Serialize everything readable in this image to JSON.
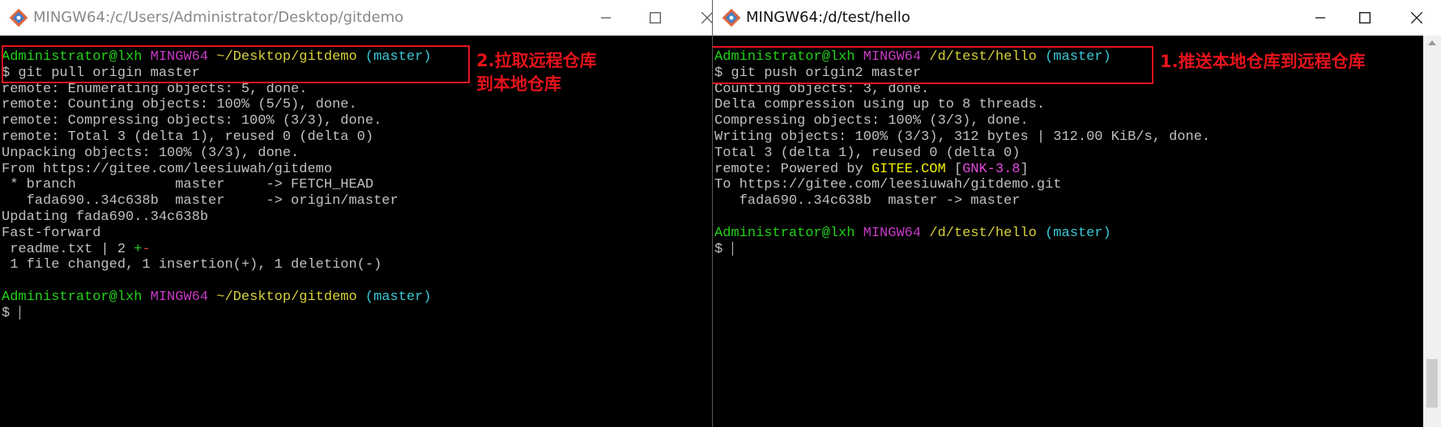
{
  "left_window": {
    "title": "MINGW64:/c/Users/Administrator/Desktop/gitdemo",
    "icon": "git-bash-icon",
    "controls": {
      "minimize": "minimize-icon",
      "maximize": "maximize-icon",
      "close": "close-icon"
    },
    "lines": [
      [
        {
          "t": "Administrator@lxh ",
          "c": "green"
        },
        {
          "t": "MINGW64 ",
          "c": "magenta"
        },
        {
          "t": "~/Desktop/gitdemo ",
          "c": "yellow"
        },
        {
          "t": "(master)",
          "c": "cyan"
        }
      ],
      [
        {
          "t": "$ git pull origin master",
          "c": "white"
        }
      ],
      [
        {
          "t": "remote: Enumerating objects: 5, done.",
          "c": "white"
        }
      ],
      [
        {
          "t": "remote: Counting objects: 100% (5/5), done.",
          "c": "white"
        }
      ],
      [
        {
          "t": "remote: Compressing objects: 100% (3/3), done.",
          "c": "white"
        }
      ],
      [
        {
          "t": "remote: Total 3 (delta 1), reused 0 (delta 0)",
          "c": "white"
        }
      ],
      [
        {
          "t": "Unpacking objects: 100% (3/3), done.",
          "c": "white"
        }
      ],
      [
        {
          "t": "From https://gitee.com/leesiuwah/gitdemo",
          "c": "white"
        }
      ],
      [
        {
          "t": " * branch            master     -> FETCH_HEAD",
          "c": "white"
        }
      ],
      [
        {
          "t": "   fada690..34c638b  master     -> origin/master",
          "c": "white"
        }
      ],
      [
        {
          "t": "Updating fada690..34c638b",
          "c": "white"
        }
      ],
      [
        {
          "t": "Fast-forward",
          "c": "white"
        }
      ],
      [
        {
          "t": " readme.txt | 2 ",
          "c": "white"
        },
        {
          "t": "+",
          "c": "green"
        },
        {
          "t": "-",
          "c": "red"
        }
      ],
      [
        {
          "t": " 1 file changed, 1 insertion(+), 1 deletion(-)",
          "c": "white"
        }
      ],
      [
        {
          "t": "",
          "c": "white"
        }
      ],
      [
        {
          "t": "Administrator@lxh ",
          "c": "green"
        },
        {
          "t": "MINGW64 ",
          "c": "magenta"
        },
        {
          "t": "~/Desktop/gitdemo ",
          "c": "yellow"
        },
        {
          "t": "(master)",
          "c": "cyan"
        }
      ],
      [
        {
          "t": "$ ",
          "c": "white"
        },
        {
          "t": "",
          "c": "cursor"
        }
      ]
    ],
    "annotation": [
      "2.拉取远程仓库",
      "到本地仓库"
    ]
  },
  "right_window": {
    "title": "MINGW64:/d/test/hello",
    "icon": "git-bash-icon",
    "controls": {
      "minimize": "minimize-icon",
      "maximize": "maximize-icon",
      "close": "close-icon"
    },
    "lines": [
      [
        {
          "t": "Administrator@lxh ",
          "c": "green"
        },
        {
          "t": "MINGW64 ",
          "c": "magenta"
        },
        {
          "t": "/d/test/hello ",
          "c": "yellow"
        },
        {
          "t": "(master)",
          "c": "cyan"
        }
      ],
      [
        {
          "t": "$ git push origin2 master",
          "c": "white"
        }
      ],
      [
        {
          "t": "Counting objects: 3, done.",
          "c": "white"
        }
      ],
      [
        {
          "t": "Delta compression using up to 8 threads.",
          "c": "white"
        }
      ],
      [
        {
          "t": "Compressing objects: 100% (3/3), done.",
          "c": "white"
        }
      ],
      [
        {
          "t": "Writing objects: 100% (3/3), 312 bytes | 312.00 KiB/s, done.",
          "c": "white"
        }
      ],
      [
        {
          "t": "Total 3 (delta 1), reused 0 (delta 0)",
          "c": "white"
        }
      ],
      [
        {
          "t": "remote: Powered by ",
          "c": "white"
        },
        {
          "t": "GITEE.COM",
          "c": "gold"
        },
        {
          "t": " [",
          "c": "white"
        },
        {
          "t": "GNK-3.8",
          "c": "mag2"
        },
        {
          "t": "]",
          "c": "white"
        }
      ],
      [
        {
          "t": "To https://gitee.com/leesiuwah/gitdemo.git",
          "c": "white"
        }
      ],
      [
        {
          "t": "   fada690..34c638b  master -> master",
          "c": "white"
        }
      ],
      [
        {
          "t": "",
          "c": "white"
        }
      ],
      [
        {
          "t": "Administrator@lxh ",
          "c": "green"
        },
        {
          "t": "MINGW64 ",
          "c": "magenta"
        },
        {
          "t": "/d/test/hello ",
          "c": "yellow"
        },
        {
          "t": "(master)",
          "c": "cyan"
        }
      ],
      [
        {
          "t": "$ ",
          "c": "white"
        },
        {
          "t": "",
          "c": "cursor"
        }
      ]
    ],
    "annotation": [
      "1.推送本地仓库到远程仓库"
    ]
  },
  "colors": {
    "terminal_bg": "#000000",
    "prompt_user": "#23d11b",
    "prompt_system": "#c839c5",
    "prompt_path": "#d8d03a",
    "prompt_branch": "#3bc8d7",
    "annotation": "#e5131b"
  }
}
